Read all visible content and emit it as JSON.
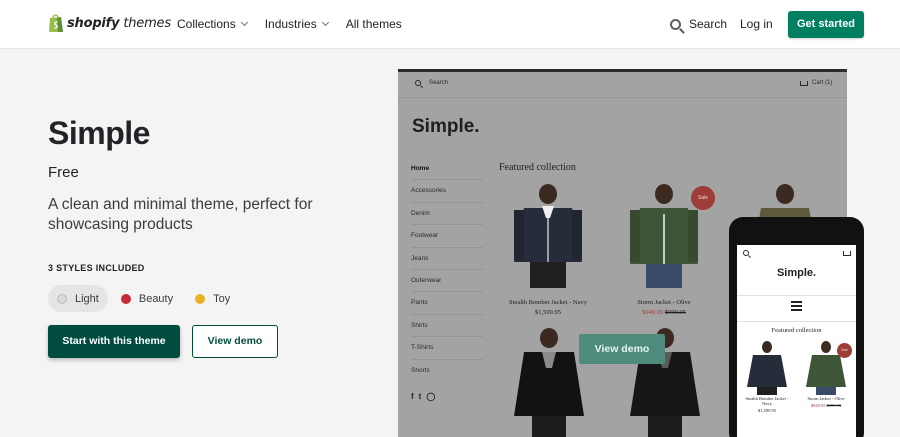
{
  "header": {
    "logo_brand": "shopify",
    "logo_suffix": "themes",
    "nav": [
      {
        "label": "Collections",
        "dropdown": true
      },
      {
        "label": "Industries",
        "dropdown": true
      },
      {
        "label": "All themes",
        "dropdown": false
      }
    ],
    "search_label": "Search",
    "login_label": "Log in",
    "cta_label": "Get started"
  },
  "theme": {
    "name": "Simple",
    "price": "Free",
    "description": "A clean and minimal theme, perfect for showcasing products",
    "styles_label": "3 STYLES INCLUDED",
    "styles": [
      {
        "label": "Light",
        "color": "#d9dadb",
        "selected": true
      },
      {
        "label": "Beauty",
        "color": "#c42b33",
        "selected": false
      },
      {
        "label": "Toy",
        "color": "#e9b224",
        "selected": false
      }
    ],
    "primary_button": "Start with this theme",
    "secondary_button": "View demo"
  },
  "desktop_preview": {
    "search_label": "Search",
    "cart_label": "Cart (1)",
    "store_name": "Simple.",
    "sidebar": [
      "Home",
      "Accessories",
      "Denim",
      "Footwear",
      "Jeans",
      "Outerwear",
      "Pants",
      "Shirts",
      "T-Shirts",
      "Shorts"
    ],
    "featured_title": "Featured collection",
    "products": [
      {
        "name": "Stealth Bomber Jacket - Navy",
        "price": "$1,599.95",
        "on_sale": false
      },
      {
        "name": "Storm Jacket - Olive",
        "price": "$949.95",
        "compare_price": "$999.95",
        "on_sale": true,
        "badge": "Sale"
      }
    ],
    "view_demo_label": "View demo",
    "colors": {
      "accent": "#4e8b7c",
      "sale": "#9e3c38"
    }
  },
  "mobile_preview": {
    "store_name": "Simple.",
    "featured_title": "Featured collection",
    "products": [
      {
        "name": "Stealth Bomber Jacket - Navy",
        "price": "$1,599.95"
      },
      {
        "name": "Storm Jacket - Olive",
        "price": "$949.95",
        "compare_price": "$999.95",
        "badge": "Sale"
      }
    ]
  }
}
